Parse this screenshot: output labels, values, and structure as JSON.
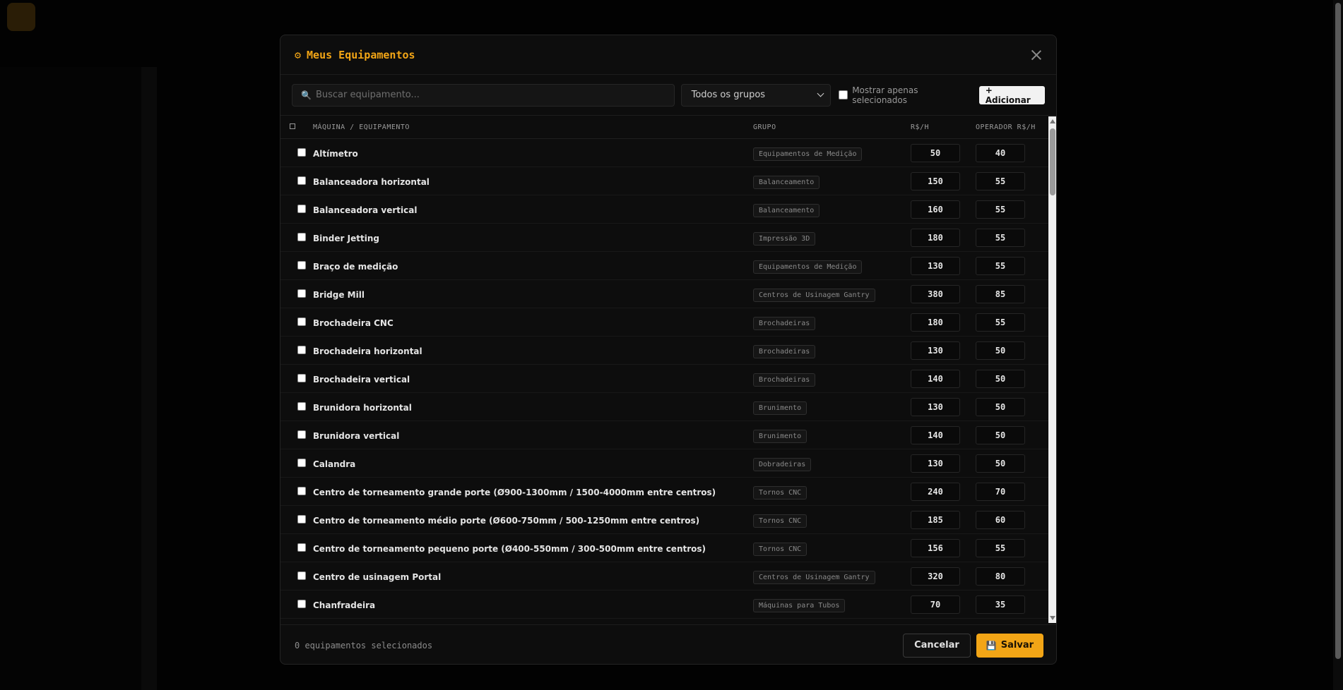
{
  "modal": {
    "title": "Meus Equipamentos",
    "search_placeholder": "Buscar equipamento...",
    "group_filter": "Todos os grupos",
    "show_selected_label": "Mostrar apenas selecionados",
    "add_label": "+ Adicionar",
    "columns": {
      "name": "MÁQUINA / EQUIPAMENTO",
      "group": "GRUPO",
      "rate": "R$/H",
      "operator": "OPERADOR R$/H"
    },
    "rows": [
      {
        "name": "Altímetro",
        "group": "Equipamentos de Medição",
        "rate": "50",
        "operator": "40"
      },
      {
        "name": "Balanceadora horizontal",
        "group": "Balanceamento",
        "rate": "150",
        "operator": "55"
      },
      {
        "name": "Balanceadora vertical",
        "group": "Balanceamento",
        "rate": "160",
        "operator": "55"
      },
      {
        "name": "Binder Jetting",
        "group": "Impressão 3D",
        "rate": "180",
        "operator": "55"
      },
      {
        "name": "Braço de medição",
        "group": "Equipamentos de Medição",
        "rate": "130",
        "operator": "55"
      },
      {
        "name": "Bridge Mill",
        "group": "Centros de Usinagem Gantry",
        "rate": "380",
        "operator": "85"
      },
      {
        "name": "Brochadeira CNC",
        "group": "Brochadeiras",
        "rate": "180",
        "operator": "55"
      },
      {
        "name": "Brochadeira horizontal",
        "group": "Brochadeiras",
        "rate": "130",
        "operator": "50"
      },
      {
        "name": "Brochadeira vertical",
        "group": "Brochadeiras",
        "rate": "140",
        "operator": "50"
      },
      {
        "name": "Brunidora horizontal",
        "group": "Brunimento",
        "rate": "130",
        "operator": "50"
      },
      {
        "name": "Brunidora vertical",
        "group": "Brunimento",
        "rate": "140",
        "operator": "50"
      },
      {
        "name": "Calandra",
        "group": "Dobradeiras",
        "rate": "130",
        "operator": "50"
      },
      {
        "name": "Centro de torneamento grande porte (Ø900-1300mm / 1500-4000mm entre centros)",
        "group": "Tornos CNC",
        "rate": "240",
        "operator": "70"
      },
      {
        "name": "Centro de torneamento médio porte (Ø600-750mm / 500-1250mm entre centros)",
        "group": "Tornos CNC",
        "rate": "185",
        "operator": "60"
      },
      {
        "name": "Centro de torneamento pequeno porte (Ø400-550mm / 300-500mm entre centros)",
        "group": "Tornos CNC",
        "rate": "156",
        "operator": "55"
      },
      {
        "name": "Centro de usinagem Portal",
        "group": "Centros de Usinagem Gantry",
        "rate": "320",
        "operator": "80"
      },
      {
        "name": "Chanfradeira",
        "group": "Máquinas para Tubos",
        "rate": "70",
        "operator": "35"
      }
    ],
    "selected_count": "0 equipamentos selecionados",
    "cancel_label": "Cancelar",
    "save_label": "Salvar"
  },
  "colors": {
    "accent": "#f2a516",
    "background": "#0d0d0d"
  },
  "icons": {
    "title": "gear-icon",
    "search": "search-icon",
    "close": "close-icon",
    "save": "floppy-disk-icon"
  }
}
